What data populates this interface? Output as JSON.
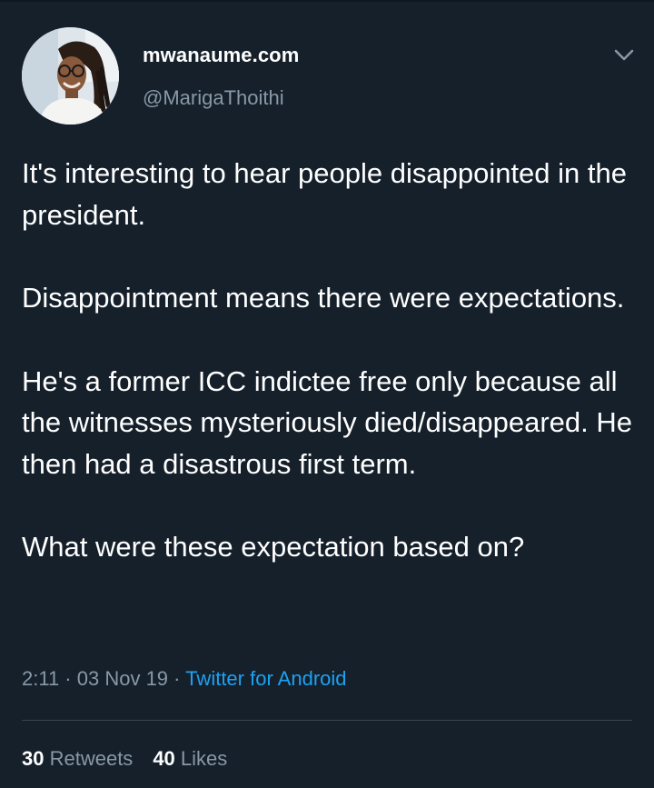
{
  "tweet": {
    "author": {
      "display_name": "mwanaume.com",
      "handle": "@MarigaThoithi"
    },
    "paragraphs": [
      "It's interesting to hear people disappointed in the president.",
      "Disappointment means there were expectations.",
      "He's a former ICC indictee free only because all the witnesses mysteriously died/disappeared. He then had a disastrous first term.",
      "What were these expectation based on?"
    ],
    "time": "2:11",
    "separator": " · ",
    "date": "03 Nov 19",
    "source": "Twitter for Android",
    "stats": {
      "retweets_count": "30",
      "retweets_label": " Retweets",
      "likes_count": "40",
      "likes_label": " Likes"
    }
  },
  "icons": {
    "avatar": "profile-photo",
    "menu": "chevron-down-icon"
  },
  "colors": {
    "background": "#15202b",
    "text": "#ffffff",
    "secondary_text": "#8899a6",
    "link": "#1da1f2",
    "divider": "#38444d"
  }
}
